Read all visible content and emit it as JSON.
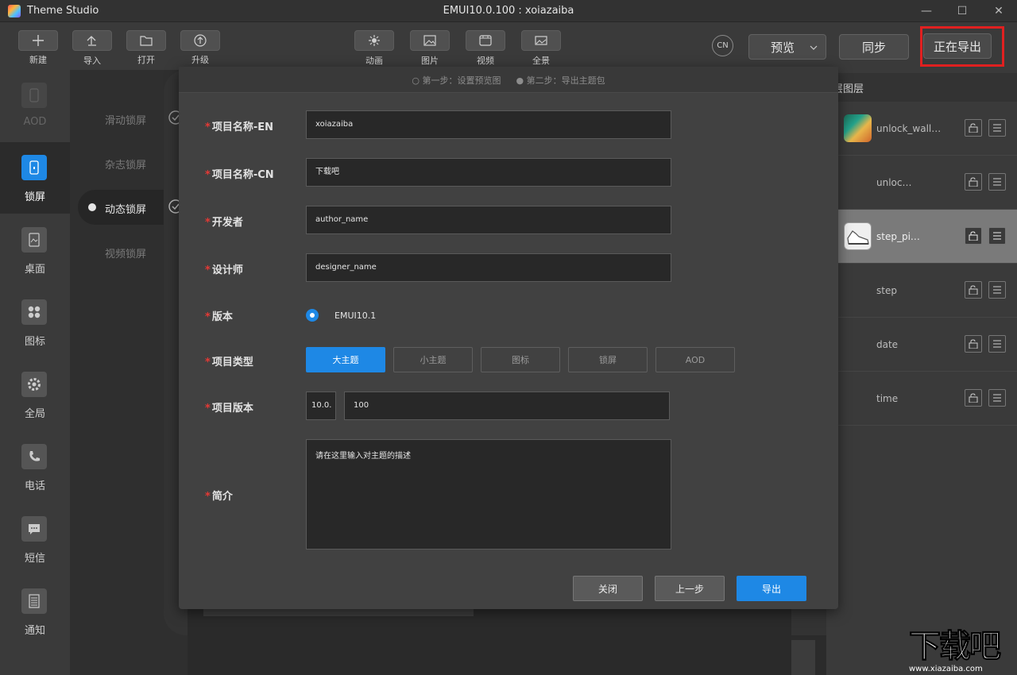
{
  "window": {
    "app_title": "Theme Studio",
    "doc_title": "EMUI10.0.100 : xoiazaiba",
    "controls": [
      "—",
      "☐",
      "✕"
    ]
  },
  "toolbar": {
    "left_buttons": [
      {
        "label": "新建",
        "icon": "plus-icon"
      },
      {
        "label": "导入",
        "icon": "import-icon"
      },
      {
        "label": "打开",
        "icon": "folder-icon"
      },
      {
        "label": "升级",
        "icon": "upgrade-icon"
      }
    ],
    "center_buttons": [
      {
        "label": "动画",
        "icon": "animation-icon"
      },
      {
        "label": "图片",
        "icon": "image-icon"
      },
      {
        "label": "视频",
        "icon": "video-icon"
      },
      {
        "label": "全景",
        "icon": "panorama-icon"
      }
    ],
    "lang": "CN",
    "preview_label": "预览",
    "sync_label": "同步",
    "export_label": "正在导出",
    "highlight_color": "#e02020"
  },
  "sidebar": {
    "items": [
      {
        "label": "AOD",
        "icon": "phone-icon",
        "active": false,
        "dim": true
      },
      {
        "label": "锁屏",
        "icon": "lock-screen-icon",
        "active": true,
        "dim": false
      },
      {
        "label": "桌面",
        "icon": "desktop-icon",
        "active": false,
        "dim": false
      },
      {
        "label": "图标",
        "icon": "icons-grid-icon",
        "active": false,
        "dim": false
      },
      {
        "label": "全局",
        "icon": "gear-icon",
        "active": false,
        "dim": false
      },
      {
        "label": "电话",
        "icon": "phone-call-icon",
        "active": false,
        "dim": false
      },
      {
        "label": "短信",
        "icon": "message-icon",
        "active": false,
        "dim": false
      },
      {
        "label": "通知",
        "icon": "notification-icon",
        "active": false,
        "dim": false
      }
    ]
  },
  "subpanel": {
    "items": [
      {
        "label": "滑动锁屏",
        "checked": true,
        "active": false
      },
      {
        "label": "杂志锁屏",
        "checked": false,
        "active": false
      },
      {
        "label": "动态锁屏",
        "checked": true,
        "active": true
      },
      {
        "label": "视频锁屏",
        "checked": false,
        "active": false
      }
    ]
  },
  "layers": {
    "header": "层图层",
    "rows": [
      {
        "name": "unlock_wall…",
        "thumb": "wallpaper-thumb",
        "selected": false
      },
      {
        "name": "unloc…",
        "thumb": "",
        "selected": false
      },
      {
        "name": "step_pi…",
        "thumb": "shoe-thumb",
        "selected": true
      },
      {
        "name": "step",
        "thumb": "",
        "selected": false
      },
      {
        "name": "date",
        "thumb": "",
        "selected": false
      },
      {
        "name": "time",
        "thumb": "",
        "selected": false
      }
    ]
  },
  "dialog": {
    "step1": "○ 第一步：设置预览图",
    "step2": "● 第二步：导出主题包",
    "fields": {
      "name_en": {
        "label": "项目名称-EN",
        "value": "xoiazaiba"
      },
      "name_cn": {
        "label": "项目名称-CN",
        "value": "下载吧"
      },
      "developer": {
        "label": "开发者",
        "value": "author_name"
      },
      "designer": {
        "label": "设计师",
        "value": "designer_name"
      },
      "version": {
        "label": "版本",
        "value": "EMUI10.1"
      },
      "type": {
        "label": "项目类型",
        "options": [
          "大主题",
          "小主题",
          "图标",
          "锁屏",
          "AOD"
        ],
        "selected": 0
      },
      "project_version": {
        "label": "项目版本",
        "prefix": "10.0.",
        "value": "100"
      },
      "intro": {
        "label": "简介",
        "value": "请在这里输入对主题的描述"
      }
    },
    "buttons": {
      "close": "关闭",
      "prev": "上一步",
      "export": "导出"
    },
    "accent": "#1e88e5"
  },
  "watermark": {
    "text": "下载吧",
    "url": "www.xiazaiba.com"
  }
}
